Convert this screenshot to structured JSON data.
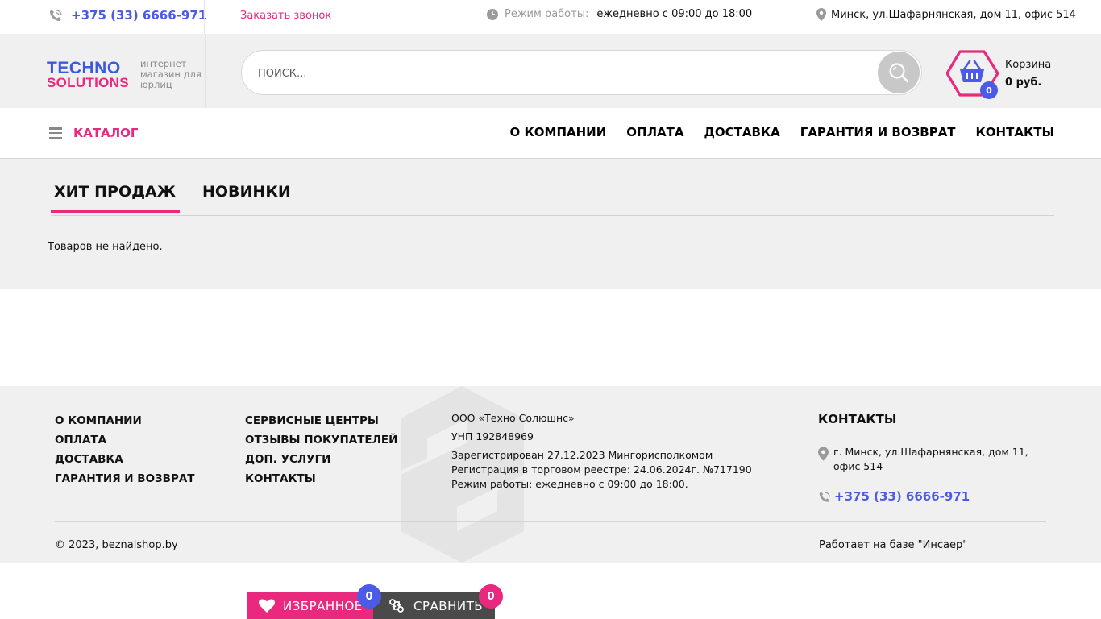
{
  "topbar": {
    "phone": "+375 (33) 6666-971",
    "callback": "Заказать звонок",
    "hours_label": "Режим работы:",
    "hours_value": "ежедневно с 09:00 до 18:00",
    "address": "Минск, ул.Шафарнянская, дом 11, офис 514"
  },
  "header": {
    "logo_line1": "TECHNO",
    "logo_line2": "SOLUTIONS",
    "tagline": "интернет магазин для юрлиц",
    "search_placeholder": "ПОИСК...",
    "cart_count": "0",
    "cart_label": "Корзина",
    "cart_sum": "0 руб."
  },
  "nav": {
    "catalog": "КАТАЛОГ",
    "links": [
      "О КОМПАНИИ",
      "ОПЛАТА",
      "ДОСТАВКА",
      "ГАРАНТИЯ И ВОЗВРАТ",
      "КОНТАКТЫ"
    ]
  },
  "main": {
    "tabs": [
      "ХИТ ПРОДАЖ",
      "НОВИНКИ"
    ],
    "empty_message": "Товаров не найдено."
  },
  "footer": {
    "col1": [
      "О КОМПАНИИ",
      "ОПЛАТА",
      "ДОСТАВКА",
      "ГАРАНТИЯ И ВОЗВРАТ"
    ],
    "col2": [
      "СЕРВИСНЫЕ ЦЕНТРЫ",
      "ОТЗЫВЫ ПОКУПАТЕЛЕЙ",
      "ДОП. УСЛУГИ",
      "КОНТАКТЫ"
    ],
    "company": "ООО «Техно Солюшнс»",
    "unp": "УНП 192848969",
    "registered": "Зарегистрирован 27.12.2023 Мингорисполкомом",
    "registry": "Регистрация в торговом реестре: 24.06.2024г. №717190",
    "schedule": "Режим работы: ежедневно с 09:00 до 18:00.",
    "contacts_title": "КОНТАКТЫ",
    "contacts_address": "г. Минск, ул.Шафарнянская, дом 11, офис 514",
    "contacts_phone": "+375 (33) 6666-971",
    "copyright": "© 2023, beznalshop.by",
    "powered": "Работает на базе \"Инсаер\""
  },
  "floating": {
    "favorites_label": "ИЗБРАННОЕ",
    "favorites_count": "0",
    "compare_label": "СРАВНИТЬ",
    "compare_count": "0"
  },
  "colors": {
    "accent_blue": "#4b5be6",
    "accent_pink": "#e8297e",
    "band_gray": "#f0f0f0"
  }
}
